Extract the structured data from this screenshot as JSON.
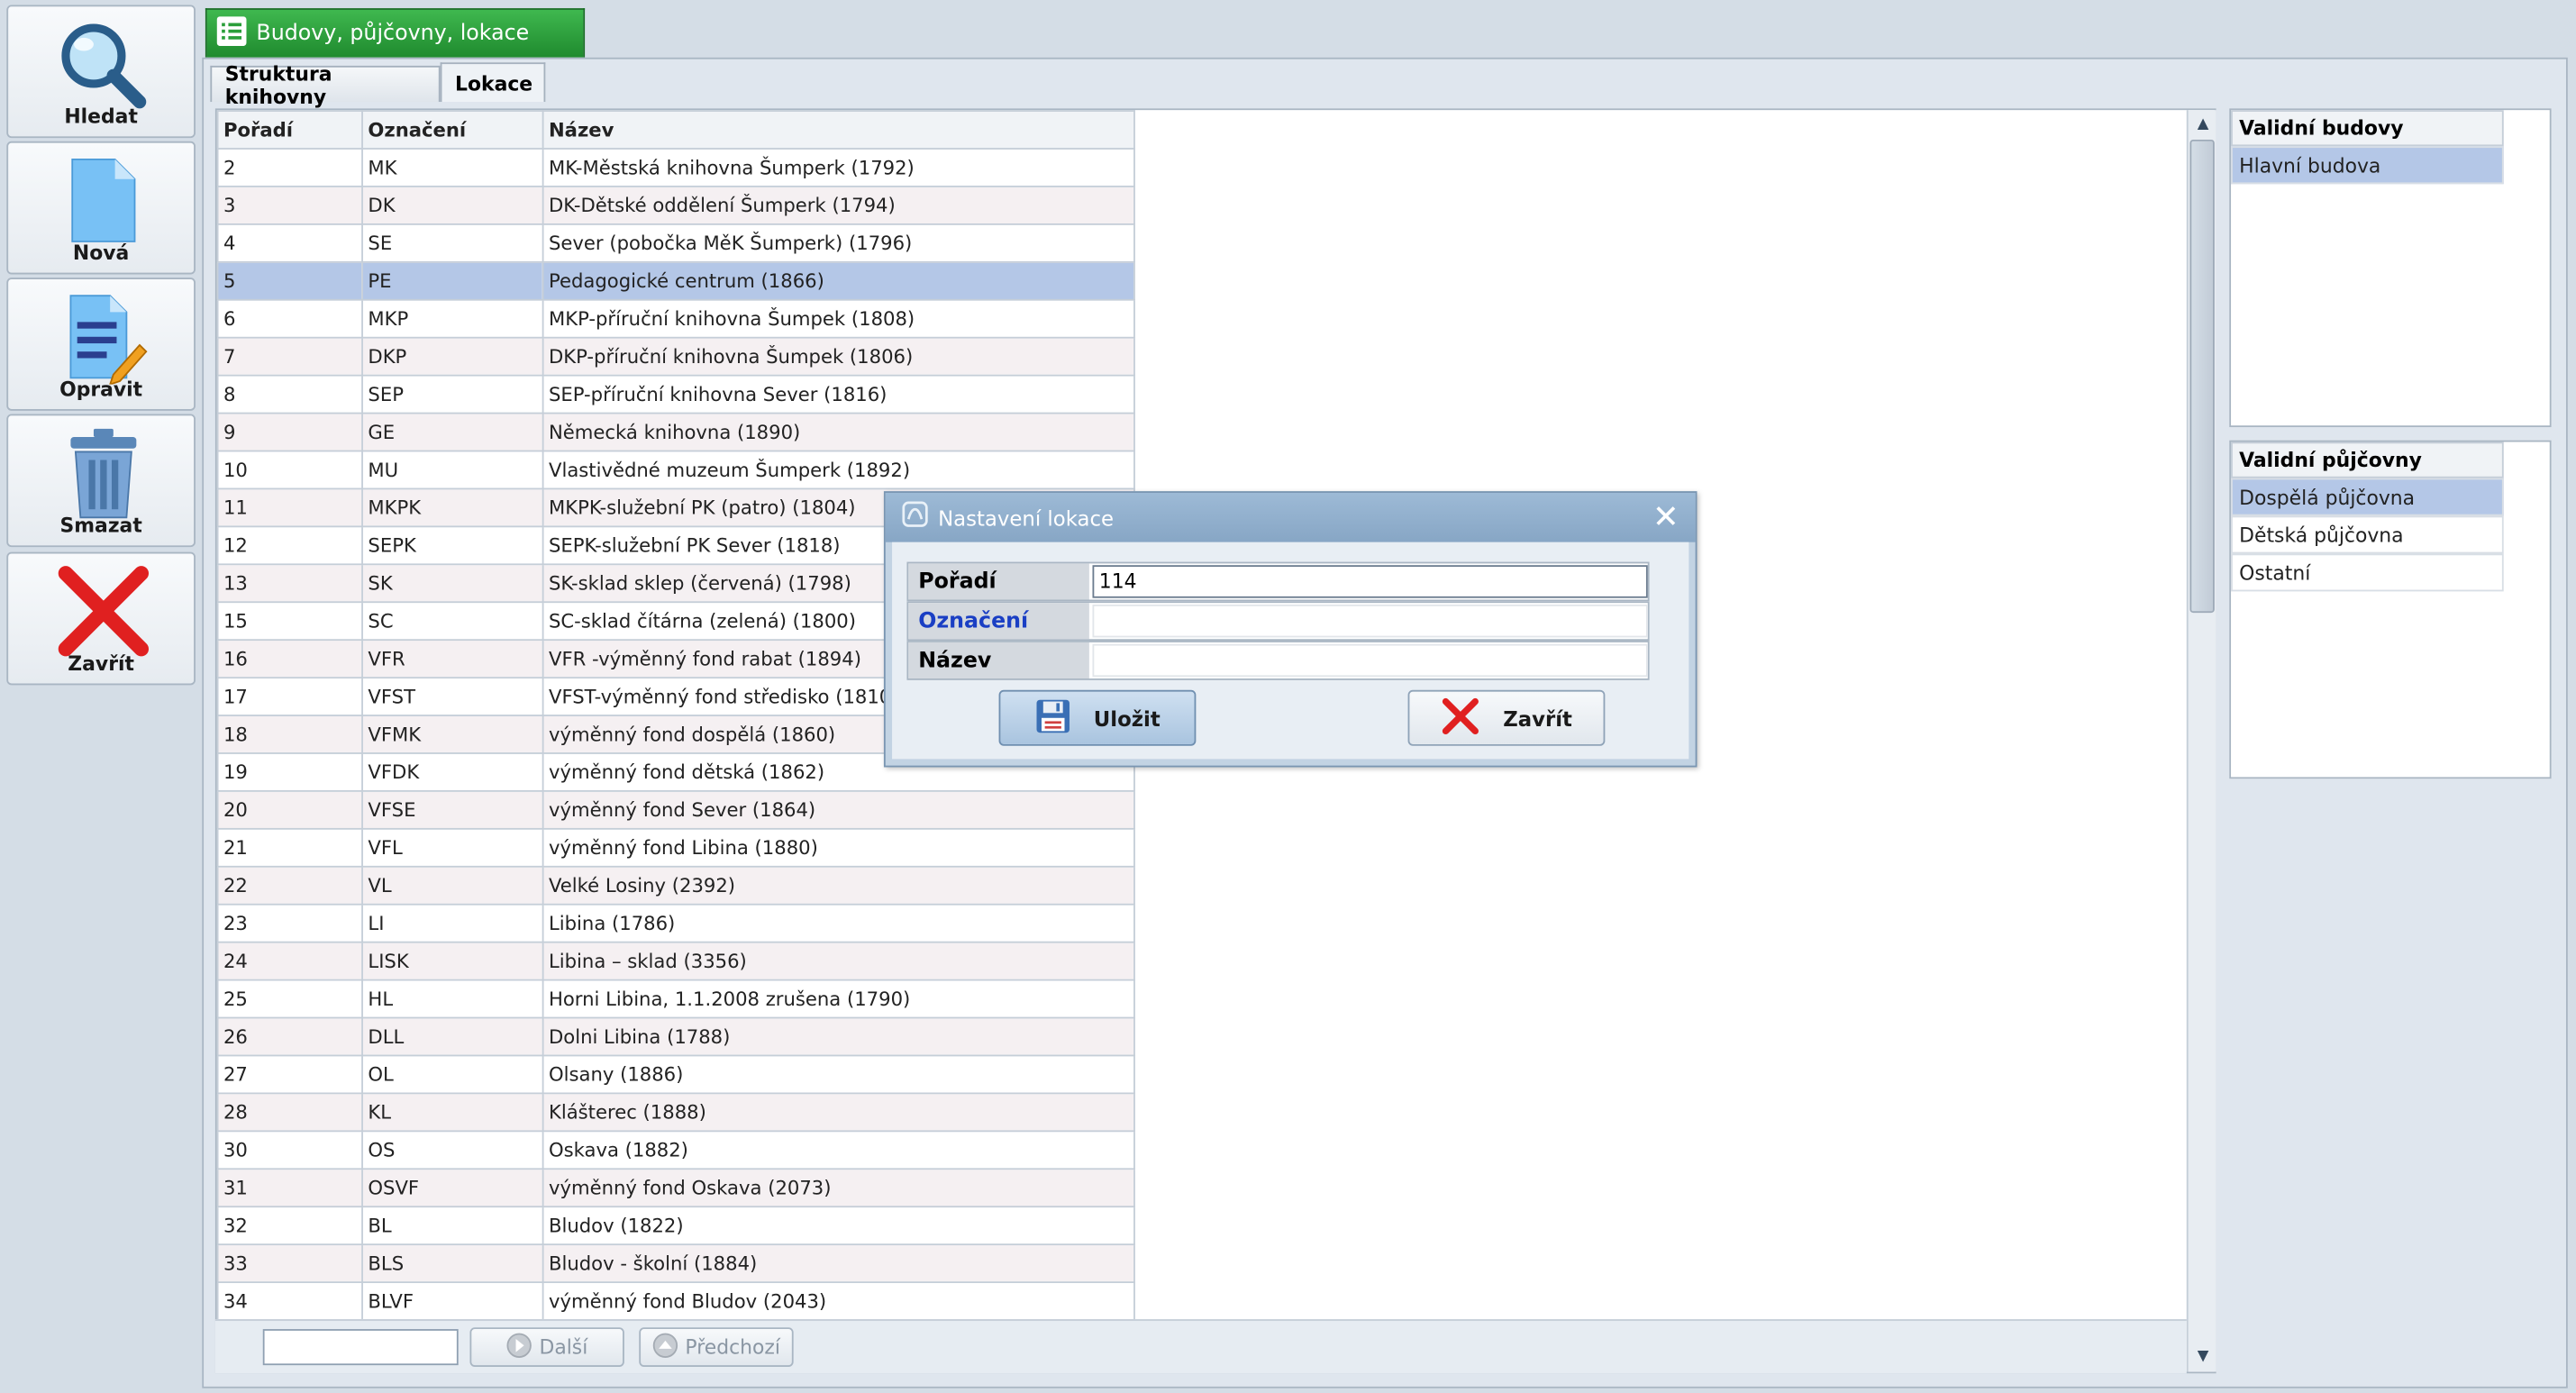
{
  "toolbar": {
    "search_label": "Hledat",
    "new_label": "Nová",
    "edit_label": "Opravit",
    "delete_label": "Smazat",
    "close_label": "Zavřít"
  },
  "module_tab": {
    "title": "Budovy, půjčovny, lokace"
  },
  "subtabs": {
    "structure": "Struktura knihovny",
    "locations": "Lokace"
  },
  "grid": {
    "columns": [
      "Pořadí",
      "Označení",
      "Název"
    ],
    "selected_index": 3,
    "rows": [
      [
        "2",
        "MK",
        "MK-Městská knihovna Šumperk (1792)"
      ],
      [
        "3",
        "DK",
        "DK-Dětské oddělení Šumperk (1794)"
      ],
      [
        "4",
        "SE",
        "Sever (pobočka MěK Šumperk) (1796)"
      ],
      [
        "5",
        "PE",
        "Pedagogické centrum (1866)"
      ],
      [
        "6",
        "MKP",
        "MKP-příruční knihovna Šumpek (1808)"
      ],
      [
        "7",
        "DKP",
        "DKP-příruční knihovna Šumpek (1806)"
      ],
      [
        "8",
        "SEP",
        "SEP-příruční knihovna Sever (1816)"
      ],
      [
        "9",
        "GE",
        "Německá knihovna (1890)"
      ],
      [
        "10",
        "MU",
        "Vlastivědné muzeum Šumperk (1892)"
      ],
      [
        "11",
        "MKPK",
        "MKPK-služební PK (patro) (1804)"
      ],
      [
        "12",
        "SEPK",
        "SEPK-služební PK Sever (1818)"
      ],
      [
        "13",
        "SK",
        "SK-sklad sklep (červená) (1798)"
      ],
      [
        "15",
        "SC",
        "SC-sklad čítárna (zelená) (1800)"
      ],
      [
        "16",
        "VFR",
        "VFR -výměnný fond rabat (1894)"
      ],
      [
        "17",
        "VFST",
        "VFST-výměnný fond středisko (1810)"
      ],
      [
        "18",
        "VFMK",
        "výměnný fond dospělá (1860)"
      ],
      [
        "19",
        "VFDK",
        "výměnný fond dětská (1862)"
      ],
      [
        "20",
        "VFSE",
        "výměnný fond Sever (1864)"
      ],
      [
        "21",
        "VFL",
        "výměnný fond Libina (1880)"
      ],
      [
        "22",
        "VL",
        "Velké Losiny (2392)"
      ],
      [
        "23",
        "LI",
        "Libina (1786)"
      ],
      [
        "24",
        "LISK",
        "Libina – sklad (3356)"
      ],
      [
        "25",
        "HL",
        "Horni Libina, 1.1.2008 zrušena (1790)"
      ],
      [
        "26",
        "DLL",
        "Dolni Libina (1788)"
      ],
      [
        "27",
        "OL",
        "Olsany (1886)"
      ],
      [
        "28",
        "KL",
        "Klášterec (1888)"
      ],
      [
        "30",
        "OS",
        "Oskava (1882)"
      ],
      [
        "31",
        "OSVF",
        "výměnný fond Oskava (2073)"
      ],
      [
        "32",
        "BL",
        "Bludov (1822)"
      ],
      [
        "33",
        "BLS",
        "Bludov - školní (1884)"
      ],
      [
        "34",
        "BLVF",
        "výměnný fond Bludov (2043)"
      ]
    ]
  },
  "pager": {
    "search_value": "",
    "next_label": "Další",
    "prev_label": "Předchozí"
  },
  "buildings": {
    "header": "Validní budovy",
    "items": [
      "Hlavní budova"
    ],
    "selected_index": 0
  },
  "branches": {
    "header": "Validní půjčovny",
    "items": [
      "Dospělá půjčovna",
      "Dětská půjčovna",
      "Ostatní"
    ],
    "selected_index": 0
  },
  "dialog": {
    "title": "Nastavení lokace",
    "fields": {
      "order_label": "Pořadí",
      "order_value": "114",
      "code_label": "Označení",
      "code_value": "",
      "name_label": "Název",
      "name_value": ""
    },
    "save_label": "Uložit",
    "close_label": "Zavřít"
  },
  "colors": {
    "accent_green": "#2a9e3a",
    "selection": "#b4c7e7",
    "required_field_label": "#1a3fc4",
    "close_red": "#e02020"
  }
}
